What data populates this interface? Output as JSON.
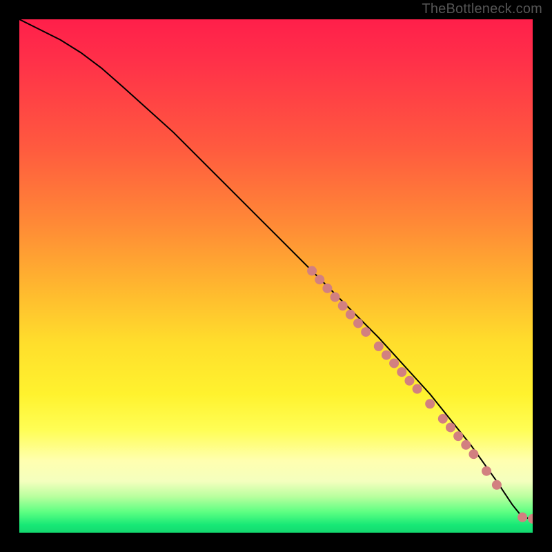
{
  "watermark": "TheBottleneck.com",
  "chart_data": {
    "type": "line",
    "title": "",
    "xlabel": "",
    "ylabel": "",
    "xlim": [
      0,
      100
    ],
    "ylim": [
      0,
      100
    ],
    "grid": false,
    "legend": false,
    "series": [
      {
        "name": "curve",
        "x": [
          0,
          4,
          8,
          12,
          16,
          20,
          30,
          40,
          50,
          60,
          70,
          80,
          88,
          93,
          96,
          98,
          100
        ],
        "y": [
          100,
          98,
          96,
          93.5,
          90.5,
          87,
          78,
          68,
          58,
          48,
          38,
          27,
          17,
          10,
          5.5,
          3,
          2.7
        ],
        "color": "#000000",
        "width": 2
      }
    ],
    "markers": [
      {
        "name": "dots",
        "color": "#d28080",
        "radius": 7,
        "points": [
          {
            "x": 57,
            "y": 51
          },
          {
            "x": 58.5,
            "y": 49.3
          },
          {
            "x": 60,
            "y": 47.6
          },
          {
            "x": 61.5,
            "y": 45.9
          },
          {
            "x": 63,
            "y": 44.2
          },
          {
            "x": 64.5,
            "y": 42.5
          },
          {
            "x": 66,
            "y": 40.8
          },
          {
            "x": 67.5,
            "y": 39.1
          },
          {
            "x": 70,
            "y": 36.3
          },
          {
            "x": 71.5,
            "y": 34.6
          },
          {
            "x": 73,
            "y": 33
          },
          {
            "x": 74.5,
            "y": 31.3
          },
          {
            "x": 76,
            "y": 29.6
          },
          {
            "x": 77.5,
            "y": 28
          },
          {
            "x": 80,
            "y": 25.1
          },
          {
            "x": 82.5,
            "y": 22.2
          },
          {
            "x": 84,
            "y": 20.5
          },
          {
            "x": 85.5,
            "y": 18.8
          },
          {
            "x": 87,
            "y": 17.1
          },
          {
            "x": 88.5,
            "y": 15.3
          },
          {
            "x": 91,
            "y": 12
          },
          {
            "x": 93,
            "y": 9.3
          },
          {
            "x": 98,
            "y": 3
          },
          {
            "x": 100,
            "y": 2.7
          }
        ]
      }
    ],
    "gradient_stops": [
      {
        "pos": 0,
        "color": "#ff1f4a"
      },
      {
        "pos": 0.4,
        "color": "#ff8a36"
      },
      {
        "pos": 0.63,
        "color": "#ffde2c"
      },
      {
        "pos": 0.8,
        "color": "#fffe55"
      },
      {
        "pos": 0.93,
        "color": "#b8ff9e"
      },
      {
        "pos": 1.0,
        "color": "#14d96f"
      }
    ]
  }
}
